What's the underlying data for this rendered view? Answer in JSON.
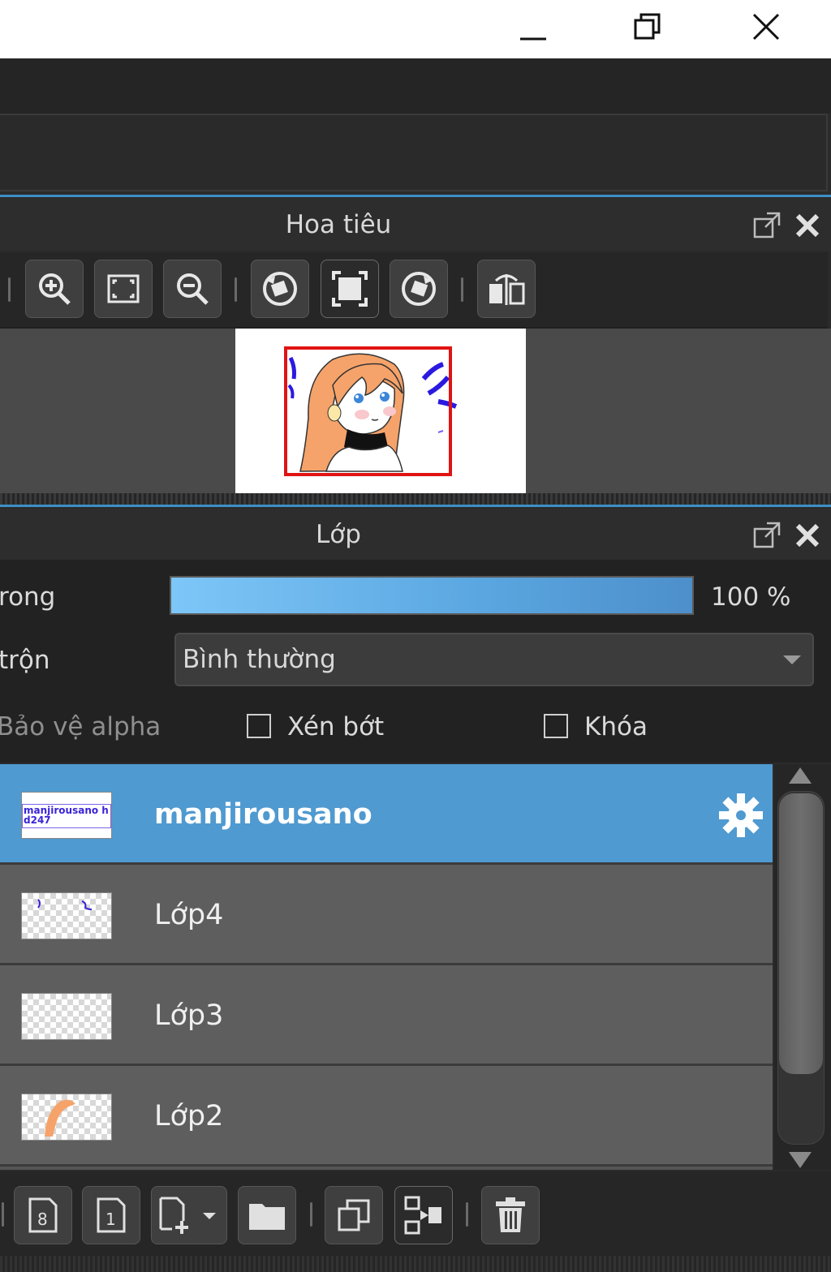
{
  "navigator": {
    "title": "Hoa tiêu"
  },
  "layers_panel": {
    "title": "Lớp",
    "opacity_label": "rong",
    "opacity_value": "100 %",
    "opacity_fraction": 1.0,
    "blend_label": "trộn",
    "blend_value": "Bình thường",
    "protect_alpha_label": "Bảo vệ alpha",
    "clip_label": "Xén bớt",
    "lock_label": "Khóa",
    "items": [
      {
        "name": "manjirousano",
        "selected": true,
        "thumb_text": "manjirousano hd247"
      },
      {
        "name": "Lớp4",
        "selected": false
      },
      {
        "name": "Lớp3",
        "selected": false
      },
      {
        "name": "Lớp2",
        "selected": false
      }
    ]
  },
  "colors": {
    "accent": "#4f9ad0",
    "selection_rect": "#e01414",
    "slider_start": "#7dc6f8",
    "slider_end": "#4d8fcb"
  }
}
